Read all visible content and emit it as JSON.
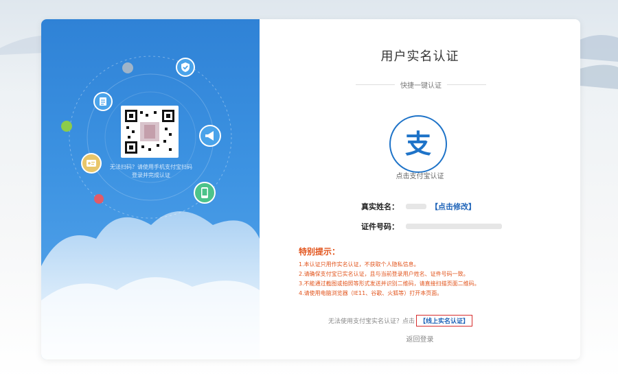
{
  "left_panel": {
    "qr_caption": "无法扫码？请使用手机支付宝扫码登录并完成认证",
    "icons": [
      "shield-check-icon",
      "document-icon",
      "megaphone-icon",
      "id-card-icon",
      "phone-icon"
    ]
  },
  "header": {
    "title": "用户实名认证",
    "subtitle": "快捷一键认证"
  },
  "alipay": {
    "glyph": "支",
    "label": "点击支付宝认证"
  },
  "form": {
    "name_label": "真实姓名：",
    "edit_link": "【点击修改】",
    "id_label": "证件号码："
  },
  "tips": {
    "title": "特别提示：",
    "items": [
      "1.本认证只用作实名认证，不获取个人隐私信息。",
      "2.请确保支付宝已实名认证，且与当前登录用户姓名、证件号码一致。",
      "3.不能通过截图或拍照等形式发送并识别二维码，请直接扫描页面二维码。",
      "4.请使用电脑浏览器（IE11、谷歌、火狐等）打开本页面。"
    ]
  },
  "footer": {
    "alt_prompt": "无法使用支付宝实名认证？点击",
    "alt_link": "【线上实名认证】",
    "back_link": "返回登录"
  },
  "colors": {
    "primary_blue": "#1e73c8",
    "tip_orange": "#e2541c",
    "highlight_red": "#d62b2b"
  }
}
